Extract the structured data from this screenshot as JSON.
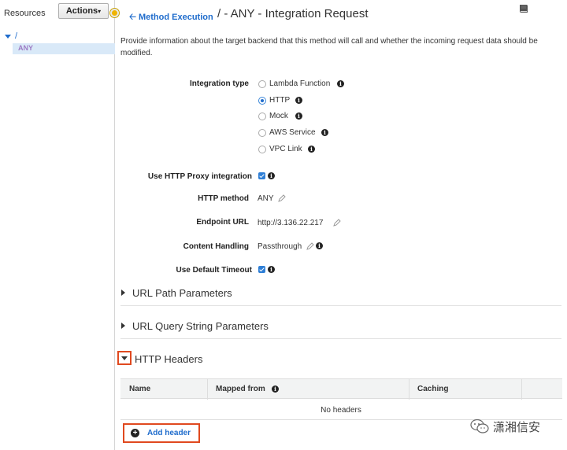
{
  "sidebar": {
    "title": "Resources",
    "actions_label": "Actions",
    "tree_root": "/",
    "tree_child": "ANY"
  },
  "header": {
    "back_link": "Method Execution",
    "title": "/ - ANY - Integration Request"
  },
  "description": "Provide information about the target backend that this method will call and whether the incoming request data should be modified.",
  "form": {
    "integration_type_label": "Integration type",
    "options": [
      "Lambda Function",
      "HTTP",
      "Mock",
      "AWS Service",
      "VPC Link"
    ],
    "selected_option": "HTTP",
    "proxy_label": "Use HTTP Proxy integration",
    "proxy_checked": true,
    "method_label": "HTTP method",
    "method_value": "ANY",
    "endpoint_label": "Endpoint URL",
    "endpoint_value": "http://3.136.22.217",
    "content_label": "Content Handling",
    "content_value": "Passthrough",
    "timeout_label": "Use Default Timeout",
    "timeout_checked": true
  },
  "sections": {
    "url_path": "URL Path Parameters",
    "url_query": "URL Query String Parameters",
    "http_headers": "HTTP Headers"
  },
  "headers_table": {
    "columns": [
      "Name",
      "Mapped from",
      "Caching"
    ],
    "empty_text": "No headers",
    "add_label": "Add header"
  },
  "watermark": {
    "text": "潇湘信安"
  },
  "colors": {
    "link": "#1f6ccc",
    "highlight": "#e0491f",
    "tree_selected_bg": "#d9e9f8"
  }
}
